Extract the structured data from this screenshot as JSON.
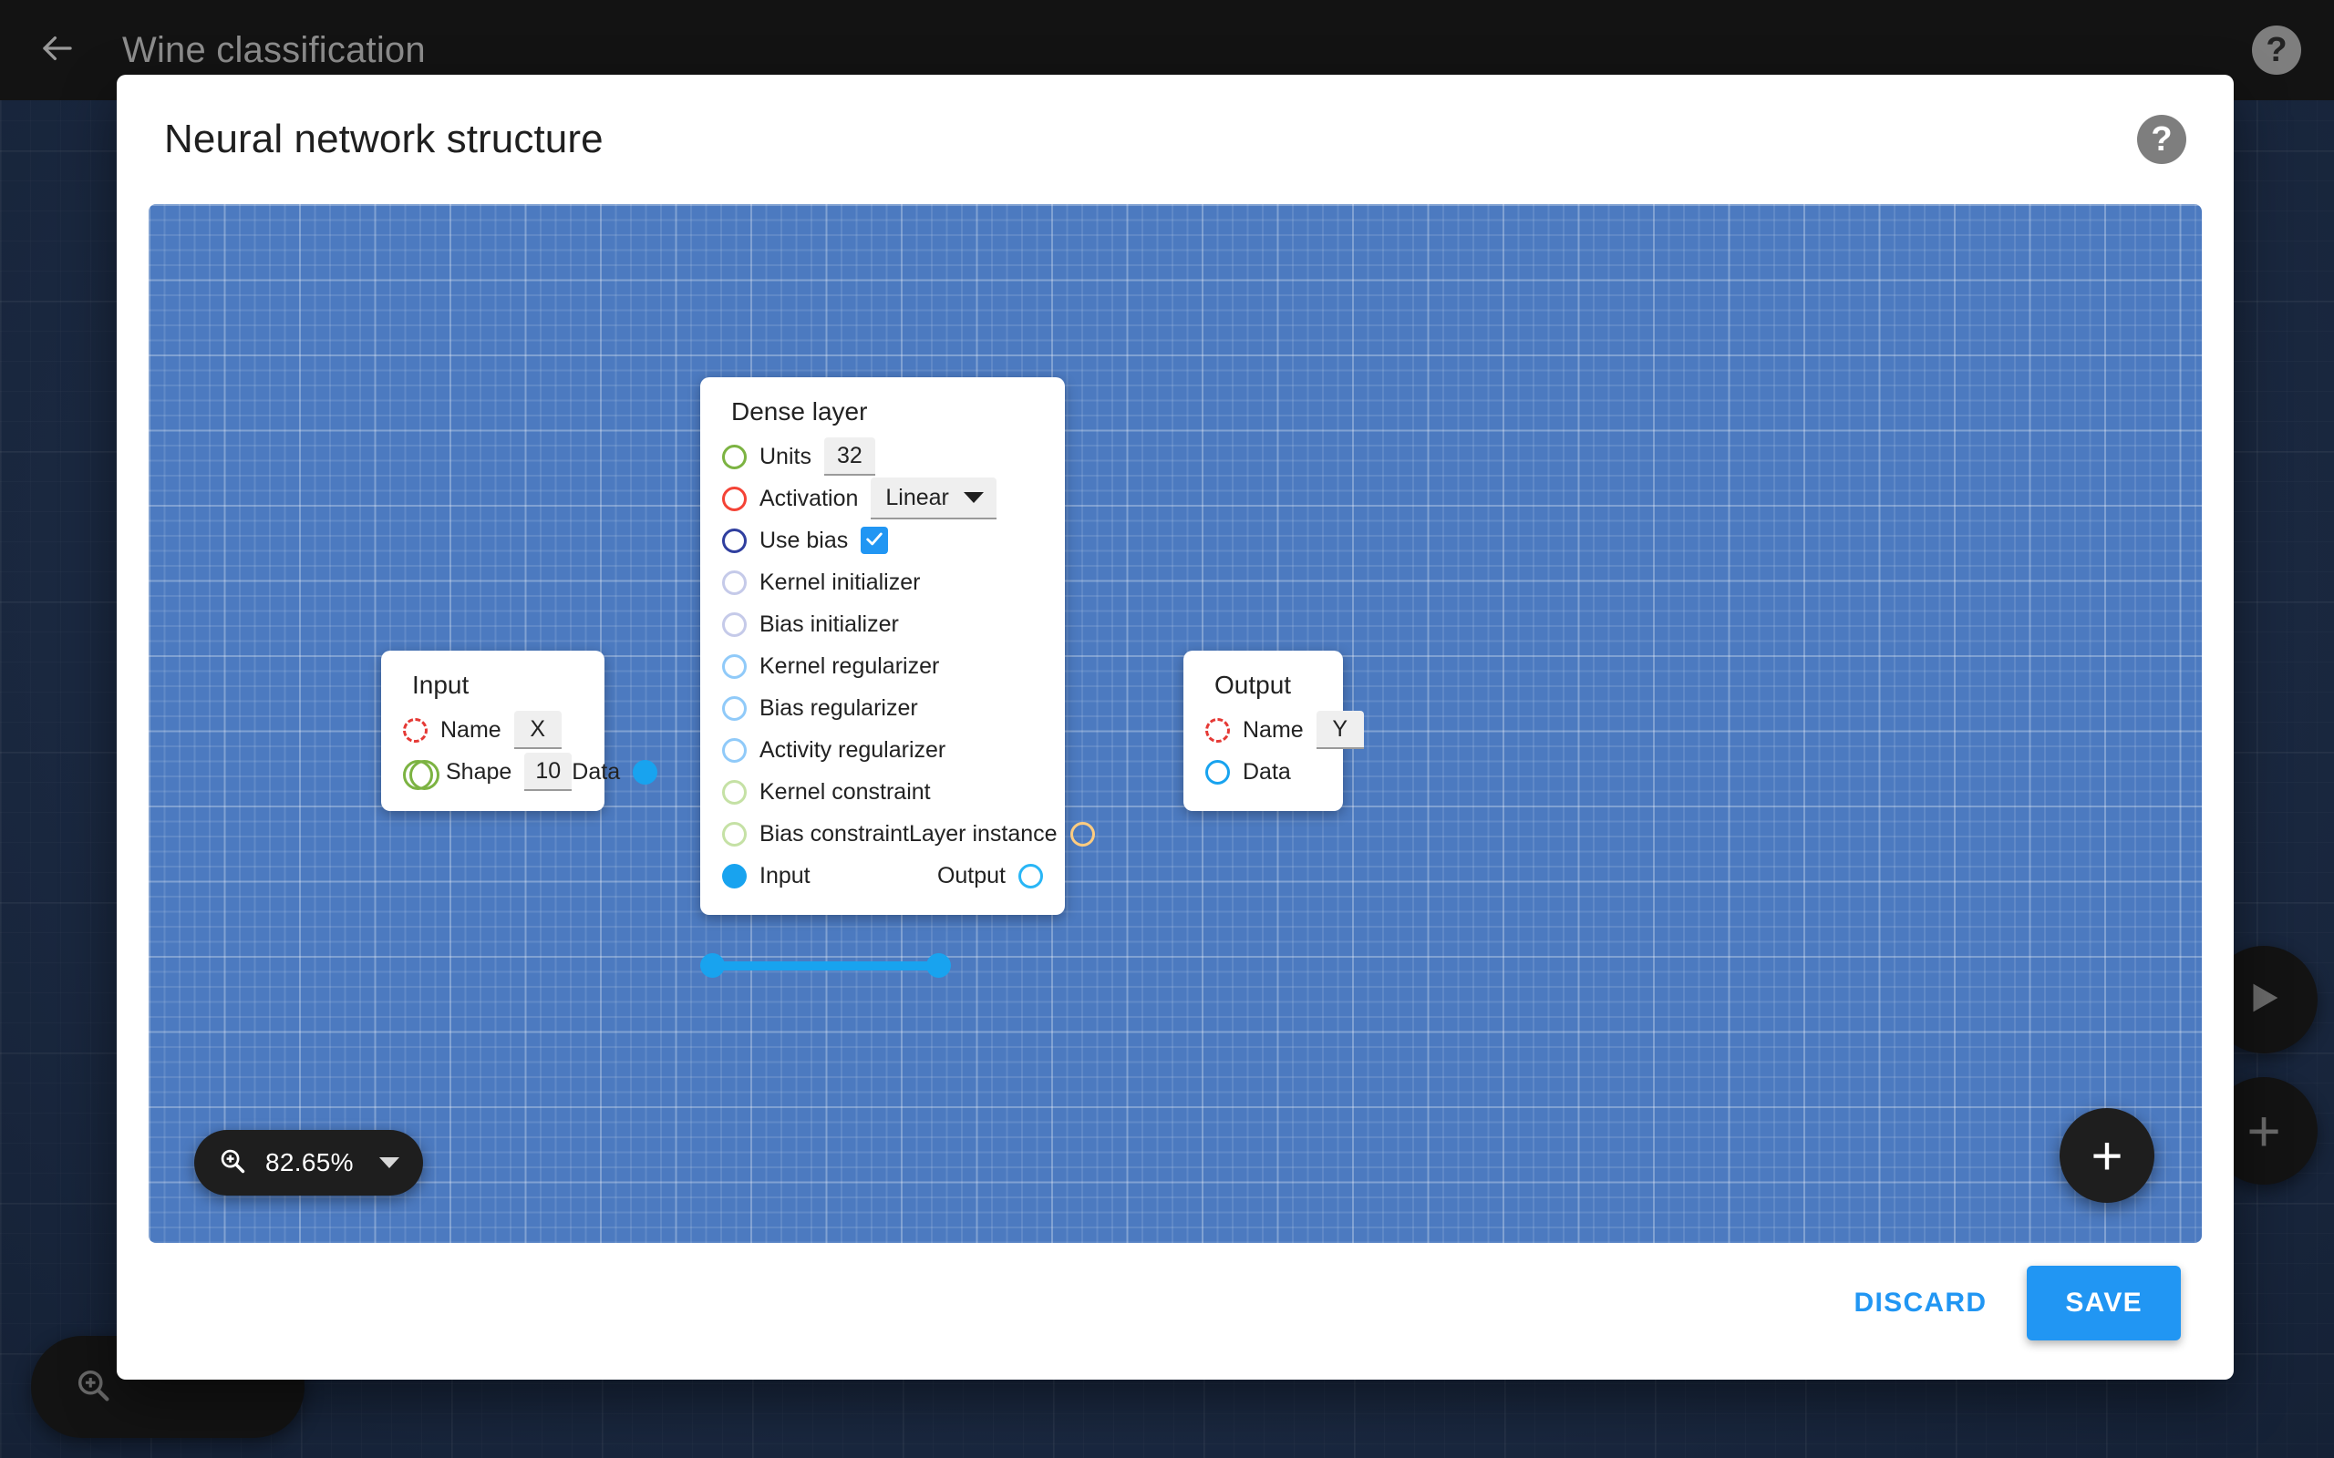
{
  "app": {
    "title": "Wine classification",
    "back_icon": "arrow-left-icon",
    "help_icon": "help-icon",
    "help_label": "?",
    "play_icon": "play-icon",
    "add_icon": "plus-icon",
    "add_label": "+",
    "zoom_icon": "zoom-in-icon"
  },
  "modal": {
    "title": "Neural network structure",
    "help_label": "?",
    "footer": {
      "discard_label": "DISCARD",
      "save_label": "SAVE"
    }
  },
  "canvas": {
    "zoom": {
      "icon": "zoom-in-icon",
      "value": "82.65%",
      "caret": "chevron-down-icon"
    },
    "add_label": "+",
    "background_color": "#4c7ac0"
  },
  "graph": {
    "nodes": [
      {
        "id": "input",
        "title": "Input",
        "rows": [
          {
            "label": "Name",
            "port_color": "#e53935",
            "port_style": "dashed",
            "value": "X"
          },
          {
            "label": "Shape",
            "port_color": "#7cb342",
            "port_style": "double",
            "value": "10"
          }
        ],
        "right_rows": [
          {
            "label": "Data",
            "port_color": "#18a3ef",
            "port_style": "filled"
          }
        ]
      },
      {
        "id": "dense",
        "title": "Dense layer",
        "rows": [
          {
            "label": "Units",
            "port_color": "#7cb342",
            "port_style": "outline",
            "value": "32"
          },
          {
            "label": "Activation",
            "port_color": "#f44336",
            "port_style": "outline",
            "value": "Linear",
            "control": "select"
          },
          {
            "label": "Use bias",
            "port_color": "#303f9f",
            "port_style": "outline",
            "value": true,
            "control": "checkbox"
          },
          {
            "label": "Kernel initializer",
            "port_color": "#c5cae9",
            "port_style": "outline"
          },
          {
            "label": "Bias initializer",
            "port_color": "#c5cae9",
            "port_style": "outline"
          },
          {
            "label": "Kernel regularizer",
            "port_color": "#90caf9",
            "port_style": "outline"
          },
          {
            "label": "Bias regularizer",
            "port_color": "#90caf9",
            "port_style": "outline"
          },
          {
            "label": "Activity regularizer",
            "port_color": "#90caf9",
            "port_style": "outline"
          },
          {
            "label": "Kernel constraint",
            "port_color": "#c5e1a5",
            "port_style": "outline"
          },
          {
            "label": "Bias constraint",
            "port_color": "#c5e1a5",
            "port_style": "outline",
            "right_label": "Layer instance",
            "right_port_color": "#ffcc80",
            "right_port_style": "outline"
          },
          {
            "label": "Input",
            "port_color": "#18a3ef",
            "port_style": "filled",
            "right_label": "Output",
            "right_port_color": "#29b6f6",
            "right_port_style": "outline"
          }
        ]
      },
      {
        "id": "output",
        "title": "Output",
        "rows": [
          {
            "label": "Name",
            "port_color": "#e53935",
            "port_style": "dashed",
            "value": "Y"
          },
          {
            "label": "Data",
            "port_color": "#18a3ef",
            "port_style": "outline"
          }
        ]
      }
    ],
    "edges": [
      {
        "from": "input.Data",
        "to": "dense.Input",
        "color": "#18a3ef"
      }
    ]
  }
}
